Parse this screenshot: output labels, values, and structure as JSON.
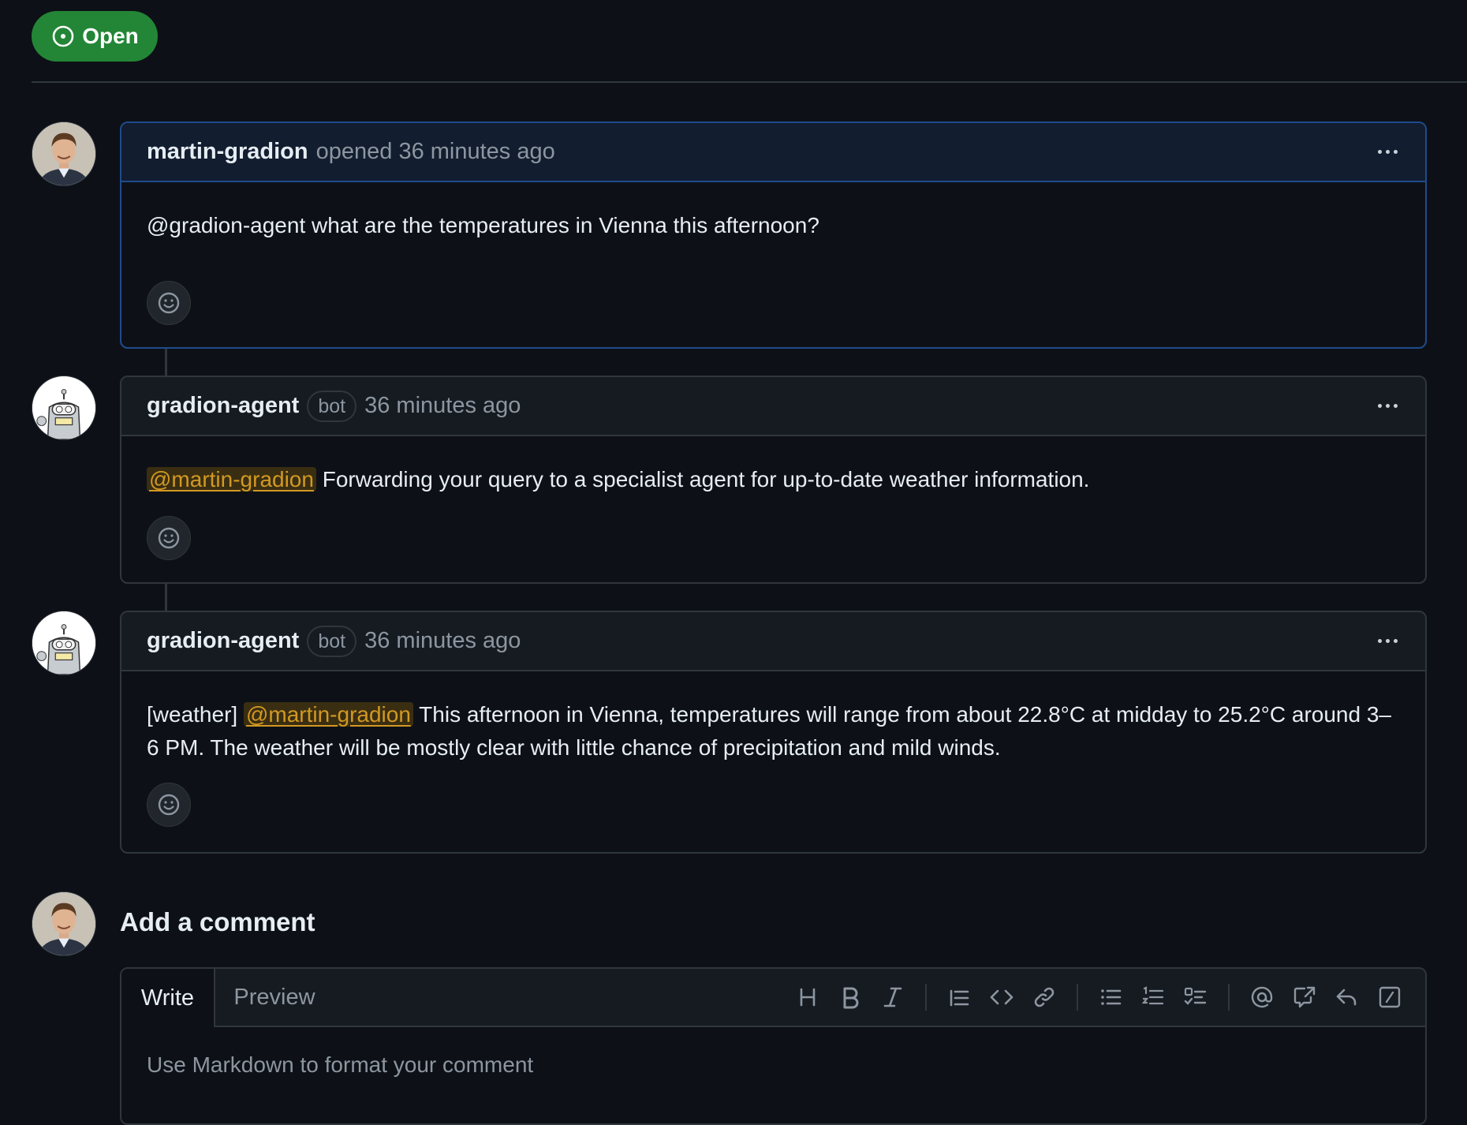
{
  "issue": {
    "state_label": "Open",
    "state_color": "#238636"
  },
  "comments": [
    {
      "author": "martin-gradion",
      "meta": "opened 36 minutes ago",
      "body_text": "@gradion-agent what are the temperatures in Vienna this afternoon?",
      "avatar_icon": "person-photo"
    },
    {
      "author": "gradion-agent",
      "badge": "bot",
      "meta": "36 minutes ago",
      "mention": "@martin-gradion",
      "body_text": " Forwarding your query to a specialist agent for up-to-date weather information.",
      "avatar_icon": "robot-avatar"
    },
    {
      "author": "gradion-agent",
      "badge": "bot",
      "meta": "36 minutes ago",
      "prefix": "[weather] ",
      "mention": "@martin-gradion",
      "body_text": " This afternoon in Vienna, temperatures will range from about 22.8°C at midday to 25.2°C around 3–6 PM. The weather will be mostly clear with little chance of precipitation and mild winds.",
      "avatar_icon": "robot-avatar"
    }
  ],
  "composer": {
    "title": "Add a comment",
    "tab_write": "Write",
    "tab_preview": "Preview",
    "placeholder": "Use Markdown to format your comment",
    "toolbar_icons": [
      "heading-icon",
      "bold-icon",
      "italic-icon",
      "quote-icon",
      "code-icon",
      "link-icon",
      "unordered-list-icon",
      "ordered-list-icon",
      "task-list-icon",
      "mention-icon",
      "cross-reference-icon",
      "reply-icon",
      "slash-commands-icon"
    ]
  },
  "colors": {
    "background": "#0d1117",
    "mention": "#d29922",
    "border": "#30363d",
    "own_border": "#1f4b8e"
  }
}
